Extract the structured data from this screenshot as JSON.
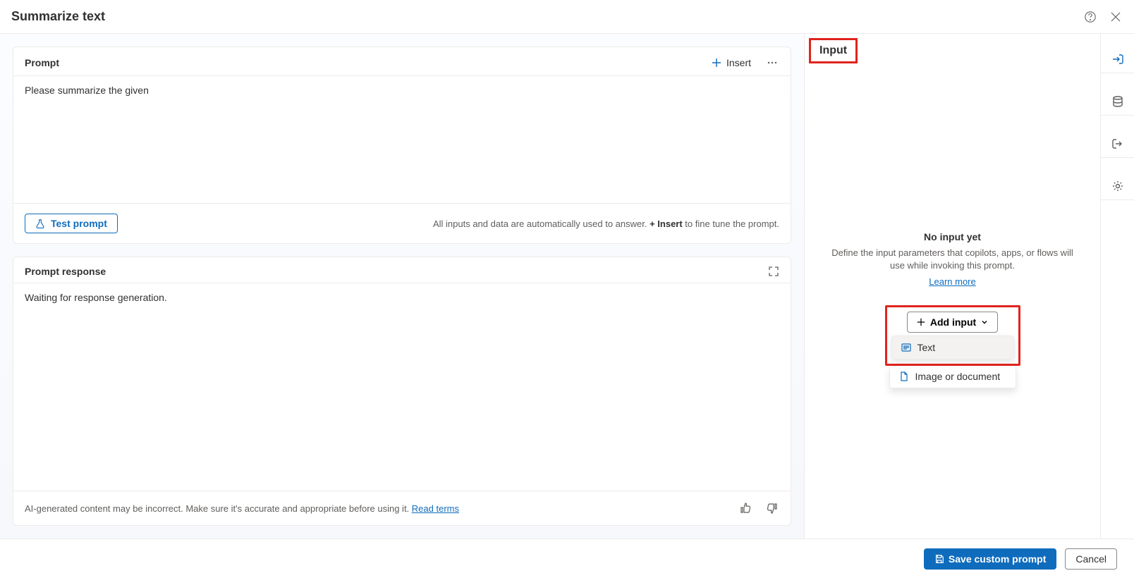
{
  "header": {
    "title": "Summarize text"
  },
  "prompt_panel": {
    "title": "Prompt",
    "insert_label": "Insert",
    "body": "Please summarize the given",
    "test_button": "Test prompt",
    "hint_prefix": "All inputs and data are automatically used to answer. ",
    "hint_plus": "+ Insert",
    "hint_suffix": " to fine tune the prompt."
  },
  "response_panel": {
    "title": "Prompt response",
    "body": "Waiting for response generation.",
    "disclaimer": "AI-generated content may be incorrect. Make sure it's accurate and appropriate before using it. ",
    "read_terms": "Read terms"
  },
  "input_panel": {
    "tab_label": "Input",
    "empty_title": "No input yet",
    "empty_desc": "Define the input parameters that copilots, apps, or flows will use while invoking this prompt.",
    "learn_more": "Learn more",
    "add_input_label": "Add input",
    "dropdown": {
      "text": "Text",
      "image_doc": "Image or document"
    }
  },
  "footer": {
    "save": "Save custom prompt",
    "cancel": "Cancel"
  }
}
